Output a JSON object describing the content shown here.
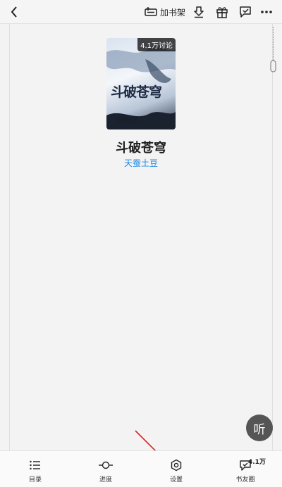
{
  "topbar": {
    "add_shelf_label": "加书架"
  },
  "book": {
    "cover_badge": "4.1万讨论",
    "cover_title": "斗破苍穹",
    "cover_author": "天蚕土豆",
    "title": "斗破苍穹",
    "author": "天蚕土豆"
  },
  "listen_label": "听",
  "bottom_nav": {
    "items": [
      {
        "label": "目录",
        "icon": "list-icon"
      },
      {
        "label": "进度",
        "icon": "progress-icon"
      },
      {
        "label": "设置",
        "icon": "settings-icon"
      },
      {
        "label": "书友圈",
        "icon": "book-circle-icon",
        "badge": "4.1万"
      }
    ]
  },
  "colors": {
    "author_link": "#1e88e5",
    "annotation_arrow": "#e02020"
  }
}
